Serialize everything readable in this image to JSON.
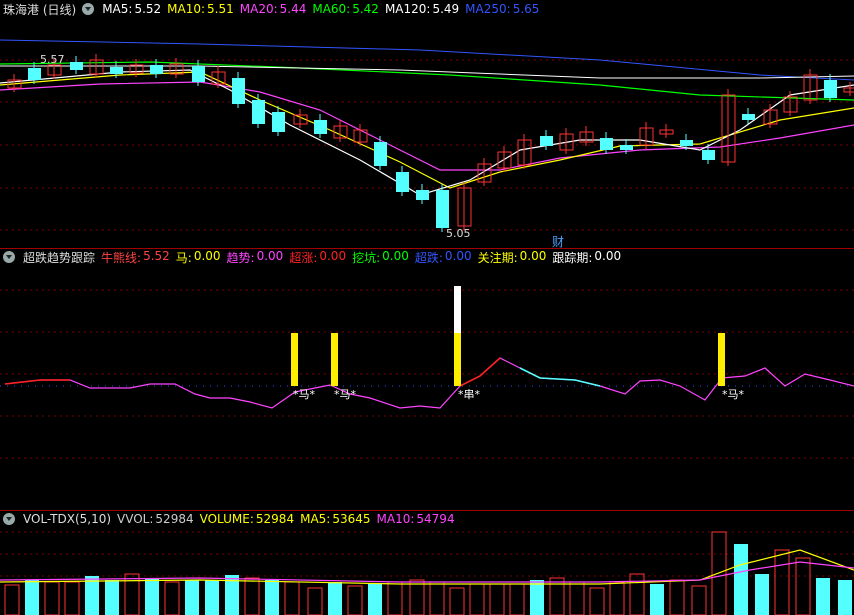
{
  "price": {
    "title": "珠海港 (日线)",
    "ma": [
      {
        "label": "MA5:",
        "value": "5.52",
        "color": "#ffffff"
      },
      {
        "label": "MA10:",
        "value": "5.51",
        "color": "#ffff00"
      },
      {
        "label": "MA20:",
        "value": "5.44",
        "color": "#ff44ff"
      },
      {
        "label": "MA60:",
        "value": "5.42",
        "color": "#00ff00"
      },
      {
        "label": "MA120:",
        "value": "5.49",
        "color": "#ffffff"
      },
      {
        "label": "MA250:",
        "value": "5.65",
        "color": "#3355ff"
      }
    ],
    "high_mark": "5.57",
    "low_mark": "5.05",
    "fin_badge": "财"
  },
  "indicator": {
    "title": "超跌趋势跟踪",
    "fields": [
      {
        "label": "牛熊线:",
        "value": "5.52",
        "color": "#ff4444"
      },
      {
        "label": "马:",
        "value": "0.00",
        "color": "#ffff00"
      },
      {
        "label": "趋势:",
        "value": "0.00",
        "color": "#ff44ff"
      },
      {
        "label": "超涨:",
        "value": "0.00",
        "color": "#ff2222"
      },
      {
        "label": "挖坑:",
        "value": "0.00",
        "color": "#00ff00"
      },
      {
        "label": "超跌:",
        "value": "0.00",
        "color": "#3355ff"
      },
      {
        "label": "关注期:",
        "value": "0.00",
        "color": "#ffff00"
      },
      {
        "label": "跟踪期:",
        "value": "0.00",
        "color": "#ffffff"
      }
    ],
    "signal_label": "*马*",
    "signal_label2": "*串*"
  },
  "volume": {
    "title": "VOL-TDX(5,10)",
    "fields": [
      {
        "label": "VVOL:",
        "value": "52984",
        "color": "#cccccc"
      },
      {
        "label": "VOLUME:",
        "value": "52984",
        "color": "#ffff00"
      },
      {
        "label": "MA5:",
        "value": "53645",
        "color": "#ffff00"
      },
      {
        "label": "MA10:",
        "value": "54794",
        "color": "#ff44ff"
      }
    ]
  },
  "colors": {
    "up": "#ff3333",
    "down": "#54ffff",
    "ma5": "#ffffff",
    "ma10": "#ffff00",
    "ma20": "#ff44ff",
    "ma60": "#00ff00",
    "ma120": "#ffffff",
    "ma250": "#3355ff",
    "grid": "#7a0000"
  }
}
